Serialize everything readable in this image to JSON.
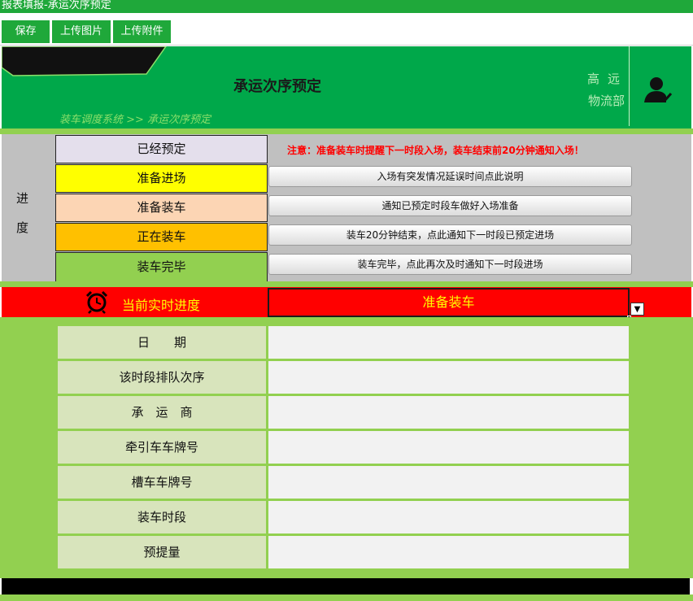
{
  "window": {
    "title": "报表填报-承运次序预定"
  },
  "toolbar": {
    "save": "保存",
    "upload_image": "上传图片",
    "upload_attachment": "上传附件"
  },
  "header": {
    "title": "承运次序预定",
    "breadcrumb": "装车调度系统 >> 承运次序预定",
    "user_name": "高远",
    "user_dept": "物流部",
    "user_icon": "user-check-icon"
  },
  "progress": {
    "label_line1": "进",
    "label_line2": "度",
    "statuses": [
      {
        "label": "已经预定",
        "color": "#e4dfec"
      },
      {
        "label": "准备进场",
        "color": "#ffff00"
      },
      {
        "label": "准备装车",
        "color": "#fcd5b4"
      },
      {
        "label": "正在装车",
        "color": "#ffc000"
      },
      {
        "label": "装车完毕",
        "color": "#92d050"
      }
    ],
    "notice": "注意：准备装车时提醒下一时段入场，装车结束前20分钟通知入场！",
    "actions": [
      "入场有突发情况延误时间点此说明",
      "通知已预定时段车做好入场准备",
      "装车20分钟结束，点此通知下一时段已预定进场",
      "装车完毕，点此再次及时通知下一时段进场"
    ]
  },
  "realtime": {
    "label": "当前实时进度",
    "value": "准备装车",
    "icon": "alarm-clock-icon"
  },
  "form": {
    "fields": [
      {
        "label": "日　　期",
        "value": ""
      },
      {
        "label": "该时段排队次序",
        "value": ""
      },
      {
        "label": "承　运　商",
        "value": ""
      },
      {
        "label": "牵引车车牌号",
        "value": ""
      },
      {
        "label": "槽车车牌号",
        "value": ""
      },
      {
        "label": "装车时段",
        "value": ""
      },
      {
        "label": "预提量",
        "value": ""
      }
    ]
  }
}
